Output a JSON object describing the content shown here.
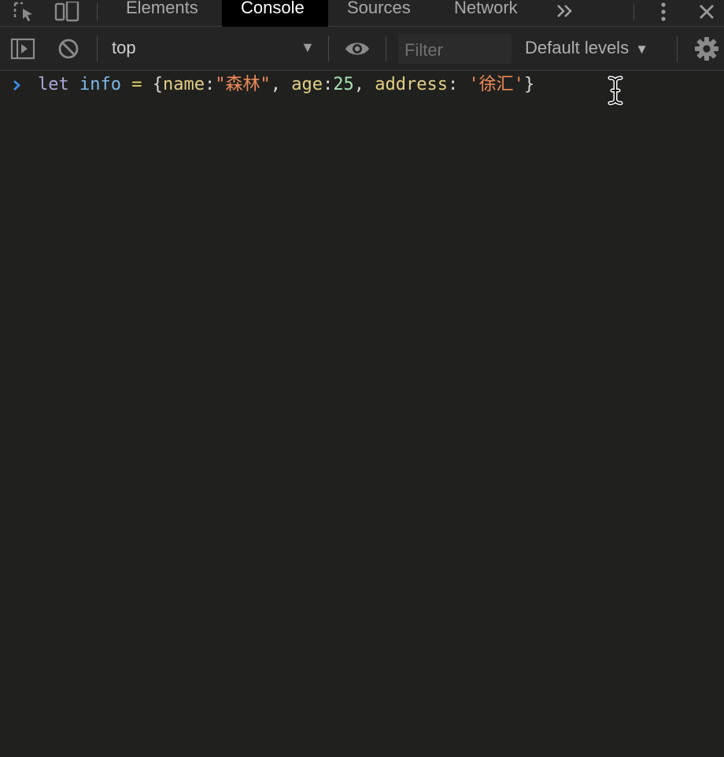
{
  "tabs": [
    {
      "label": "Elements",
      "active": false
    },
    {
      "label": "Console",
      "active": true
    },
    {
      "label": "Sources",
      "active": false
    },
    {
      "label": "Network",
      "active": false
    }
  ],
  "tabbar_icons": {
    "inspect": "inspect-element-icon",
    "device": "device-toolbar-icon",
    "more_tabs": "more-tabs-chevron-icon",
    "menu": "kebab-menu-icon",
    "close": "close-icon"
  },
  "toolbar": {
    "sidebar_icon": "show-sidebar-icon",
    "clear_icon": "clear-console-icon",
    "context": "top",
    "eye_icon": "live-expression-eye-icon",
    "filter_placeholder": "Filter",
    "filter_value": "",
    "levels": "Default levels",
    "settings_icon": "gear-icon"
  },
  "console": {
    "prompt_icon": "prompt-chevron-icon",
    "input_tokens": [
      {
        "text": "let",
        "kind": "kw"
      },
      {
        "text": " ",
        "kind": "punc"
      },
      {
        "text": "info",
        "kind": "var"
      },
      {
        "text": " ",
        "kind": "punc"
      },
      {
        "text": "=",
        "kind": "op"
      },
      {
        "text": " {",
        "kind": "punc"
      },
      {
        "text": "name",
        "kind": "prop"
      },
      {
        "text": ":",
        "kind": "punc"
      },
      {
        "text": "\"森林\"",
        "kind": "str"
      },
      {
        "text": ", ",
        "kind": "punc"
      },
      {
        "text": "age",
        "kind": "prop"
      },
      {
        "text": ":",
        "kind": "punc"
      },
      {
        "text": "25",
        "kind": "num"
      },
      {
        "text": ", ",
        "kind": "punc"
      },
      {
        "text": "address",
        "kind": "prop"
      },
      {
        "text": ": ",
        "kind": "punc"
      },
      {
        "text": "'徐汇'",
        "kind": "str"
      },
      {
        "text": "}",
        "kind": "punc"
      }
    ]
  },
  "colors": {
    "background": "#20211e",
    "toolbar": "#242424",
    "active_tab": "#000000",
    "prompt": "#3b8eea",
    "keyword": "#a9a6d9",
    "variable": "#7fb8e8",
    "string": "#ee8a5a",
    "number": "#a6e0b0",
    "property": "#e3cf86"
  }
}
